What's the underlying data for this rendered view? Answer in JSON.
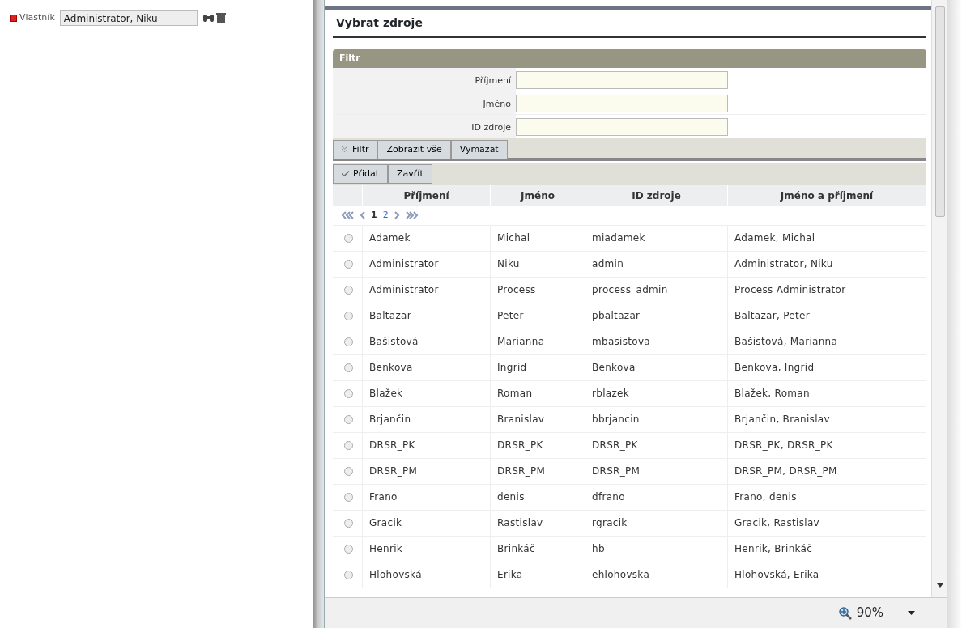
{
  "owner_field": {
    "label": "Vlastník",
    "value": "Administrator, Niku"
  },
  "dialog": {
    "title": "Vybrat zdroje",
    "filter": {
      "title": "Filtr",
      "fields": [
        {
          "label": "Příjmení"
        },
        {
          "label": "Jméno"
        },
        {
          "label": "ID zdroje"
        }
      ],
      "buttons": [
        {
          "label": "Filtr",
          "kind": "toggle"
        },
        {
          "label": "Zobrazit vše",
          "kind": "plain"
        },
        {
          "label": "Vymazat",
          "kind": "plain"
        }
      ]
    },
    "actions": [
      {
        "label": "Přidat",
        "kind": "confirm"
      },
      {
        "label": "Zavřít",
        "kind": "plain"
      }
    ],
    "table": {
      "columns": [
        "Příjmení",
        "Jméno",
        "ID zdroje",
        "Jméno a příjmení"
      ],
      "pager": {
        "pages": [
          {
            "label": "1",
            "selected": true
          },
          {
            "label": "2",
            "selected": false
          }
        ]
      },
      "rows": [
        {
          "cells": [
            "Adamek",
            "Michal",
            "miadamek",
            "Adamek, Michal"
          ],
          "selected": false
        },
        {
          "cells": [
            "Administrator",
            "Niku",
            "admin",
            "Administrator, Niku"
          ],
          "selected": false
        },
        {
          "cells": [
            "Administrator",
            "Process",
            "process_admin",
            "Process Administrator"
          ],
          "selected": false
        },
        {
          "cells": [
            "Baltazar",
            "Peter",
            "pbaltazar",
            "Baltazar, Peter"
          ],
          "selected": false
        },
        {
          "cells": [
            "Bašistová",
            "Marianna",
            "mbasistova",
            "Bašistová, Marianna"
          ],
          "selected": false
        },
        {
          "cells": [
            "Benkova",
            "Ingrid",
            "Benkova",
            "Benkova, Ingrid"
          ],
          "selected": false
        },
        {
          "cells": [
            "Blažek",
            "Roman",
            "rblazek",
            "Blažek, Roman"
          ],
          "selected": false
        },
        {
          "cells": [
            "Brjančin",
            "Branislav",
            "bbrjancin",
            "Brjančin, Branislav"
          ],
          "selected": false
        },
        {
          "cells": [
            "DRSR_PK",
            "DRSR_PK",
            "DRSR_PK",
            "DRSR_PK, DRSR_PK"
          ],
          "selected": false
        },
        {
          "cells": [
            "DRSR_PM",
            "DRSR_PM",
            "DRSR_PM",
            "DRSR_PM, DRSR_PM"
          ],
          "selected": false
        },
        {
          "cells": [
            "Frano",
            "denis",
            "dfrano",
            "Frano, denis"
          ],
          "selected": false
        },
        {
          "cells": [
            "Gracik",
            "Rastislav",
            "rgracik",
            "Gracik, Rastislav"
          ],
          "selected": false
        },
        {
          "cells": [
            "Henrik",
            "Brinkáč",
            "hb",
            "Henrik, Brinkáč"
          ],
          "selected": false
        },
        {
          "cells": [
            "Hlohovská",
            "Erika",
            "ehlohovska",
            "Hlohovská, Erika"
          ],
          "selected": false
        }
      ]
    }
  },
  "status_bar": {
    "zoom": "90%"
  }
}
